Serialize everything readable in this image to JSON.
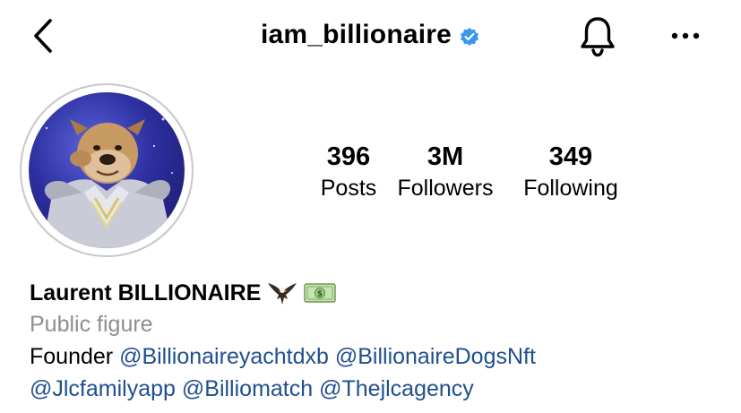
{
  "header": {
    "username": "iam_billionaire",
    "back_icon": "chevron-left-icon",
    "verified_icon": "verified-badge-icon",
    "bell_icon": "bell-icon",
    "more_icon": "more-horizontal-icon"
  },
  "stats": {
    "posts": {
      "value": "396",
      "label": "Posts"
    },
    "followers": {
      "value": "3M",
      "label": "Followers"
    },
    "following": {
      "value": "349",
      "label": "Following"
    }
  },
  "bio": {
    "display_name": "Laurent BILLIONAIRE",
    "emojis": [
      "eagle-emoji",
      "money-bill-emoji"
    ],
    "category": "Public figure",
    "founder_label": "Founder",
    "mentions_line1": [
      "@Billionaireyachtdxb",
      "@BillionaireDogsNft"
    ],
    "mentions_line2": [
      "@Jlcfamilyapp",
      "@Billiomatch",
      "@Thejlcagency"
    ]
  },
  "colors": {
    "verified": "#3897f0",
    "mention": "#1f4f8f",
    "category": "#8e8e93",
    "avatar_ring": "#c7c7cc"
  }
}
